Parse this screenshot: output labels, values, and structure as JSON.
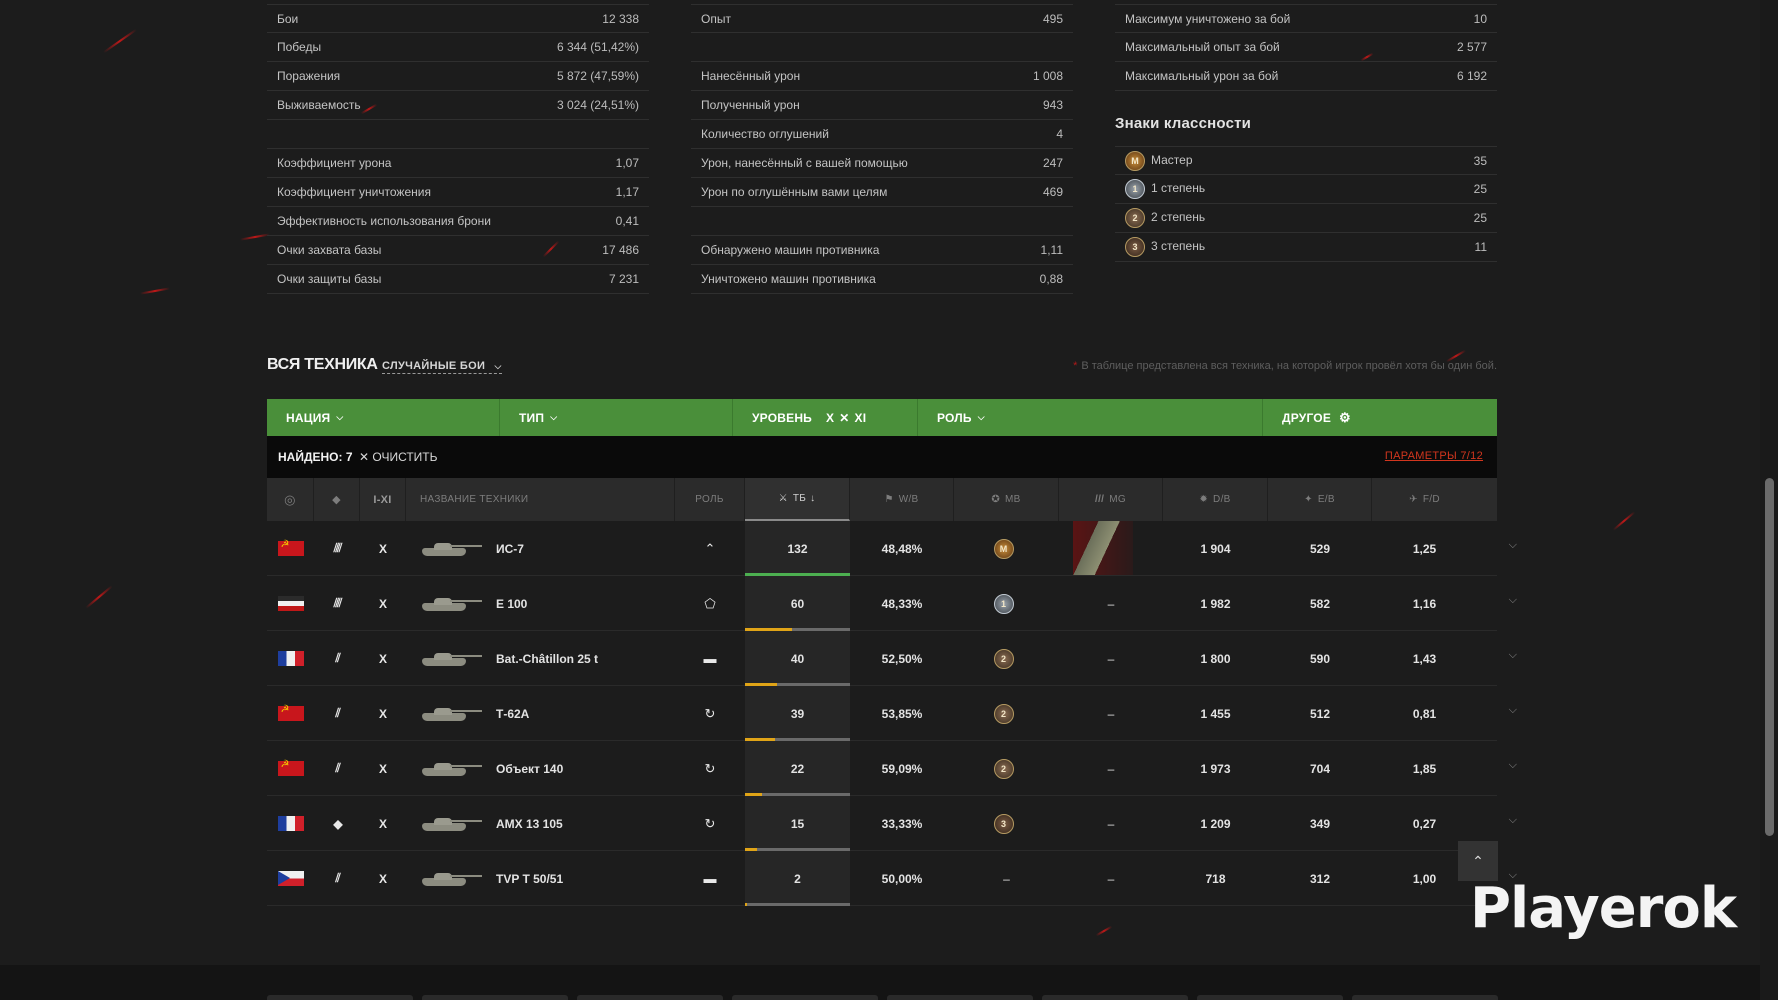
{
  "stats": {
    "col1": [
      {
        "label": "Бои",
        "value": "12 338"
      },
      {
        "label": "Победы",
        "value": "6 344 (51,42%)"
      },
      {
        "label": "Поражения",
        "value": "5 872 (47,59%)"
      },
      {
        "label": "Выживаемость",
        "value": "3 024 (24,51%)"
      },
      null,
      {
        "label": "Коэффициент урона",
        "value": "1,07"
      },
      {
        "label": "Коэффициент уничтожения",
        "value": "1,17"
      },
      {
        "label": "Эффективность использования брони",
        "value": "0,41"
      },
      {
        "label": "Очки захвата базы",
        "value": "17 486"
      },
      {
        "label": "Очки защиты базы",
        "value": "7 231"
      }
    ],
    "col2": [
      {
        "label": "Опыт",
        "value": "495"
      },
      null,
      {
        "label": "Нанесённый урон",
        "value": "1 008"
      },
      {
        "label": "Полученный урон",
        "value": "943"
      },
      {
        "label": "Количество оглушений",
        "value": "4"
      },
      {
        "label": "Урон, нанесённый с вашей помощью",
        "value": "247"
      },
      {
        "label": "Урон по оглушённым вами целям",
        "value": "469"
      },
      null,
      {
        "label": "Обнаружено машин противника",
        "value": "1,11"
      },
      {
        "label": "Уничтожено машин противника",
        "value": "0,88"
      }
    ],
    "col3": [
      {
        "label": "Максимум уничтожено за бой",
        "value": "10"
      },
      {
        "label": "Максимальный опыт за бой",
        "value": "2 577"
      },
      {
        "label": "Максимальный урон за бой",
        "value": "6 192"
      }
    ],
    "class_marks_title": "Знаки классности",
    "class_marks": [
      {
        "medal": "М",
        "label": "Мастер",
        "value": "35",
        "cls": "m"
      },
      {
        "medal": "1",
        "label": "1 степень",
        "value": "25",
        "cls": "s1"
      },
      {
        "medal": "2",
        "label": "2 степень",
        "value": "25",
        "cls": "s2"
      },
      {
        "medal": "3",
        "label": "3 степень",
        "value": "11",
        "cls": "s3"
      }
    ]
  },
  "section": {
    "title": "ВСЯ ТЕХНИКА",
    "battle_type": "СЛУЧАЙНЫЕ БОИ",
    "note": "В таблице представлена вся техника, на которой игрок провёл хотя бы один бой."
  },
  "filters": {
    "nation": "НАЦИЯ",
    "type": "ТИП",
    "level": "УРОВЕНЬ",
    "level_value": "X",
    "level_value2": "XI",
    "role": "РОЛЬ",
    "other": "ДРУГОЕ"
  },
  "found": {
    "label": "НАЙДЕНО: 7",
    "clear": "ОЧИСТИТЬ",
    "params": "ПАРАМЕТРЫ 7/12"
  },
  "columns": {
    "levels": "I-XI",
    "name": "НАЗВАНИЕ ТЕХНИКИ",
    "role": "РОЛЬ",
    "tb": "ТБ",
    "wb": "W/B",
    "mb": "МВ",
    "mg": "MG",
    "db": "D/B",
    "eb": "E/B",
    "fd": "F/D"
  },
  "rows": [
    {
      "flag": "ussr",
      "type": "heavy-tank-icon",
      "type_glyph": "⫽⫽",
      "level": "X",
      "name": "ИС-7",
      "role": "⌃",
      "tb": "132",
      "tb_pct": 100,
      "tb_color": "#4caf50",
      "wb": "48,48%",
      "mb": "М",
      "mb_cls": "m",
      "mg": "",
      "mg_stripe": true,
      "db": "1 904",
      "eb": "529",
      "fd": "1,25"
    },
    {
      "flag": "germany",
      "type": "heavy-tank-icon",
      "type_glyph": "⫽⫽",
      "level": "X",
      "name": "E 100",
      "role": "⬠",
      "tb": "60",
      "tb_pct": 45,
      "tb_color": "#e0a417",
      "wb": "48,33%",
      "mb": "1",
      "mb_cls": "s1",
      "mg": "–",
      "db": "1 982",
      "eb": "582",
      "fd": "1,16"
    },
    {
      "flag": "france",
      "type": "medium-tank-icon",
      "type_glyph": "⫽",
      "level": "X",
      "name": "Bat.-Châtillon 25 t",
      "role": "▬",
      "tb": "40",
      "tb_pct": 30,
      "tb_color": "#e0a417",
      "wb": "52,50%",
      "mb": "2",
      "mb_cls": "s2",
      "mg": "–",
      "db": "1 800",
      "eb": "590",
      "fd": "1,43"
    },
    {
      "flag": "ussr",
      "type": "medium-tank-icon",
      "type_glyph": "⫽",
      "level": "X",
      "name": "Т-62А",
      "role": "↻",
      "tb": "39",
      "tb_pct": 29,
      "tb_color": "#e0a417",
      "wb": "53,85%",
      "mb": "2",
      "mb_cls": "s2",
      "mg": "–",
      "db": "1 455",
      "eb": "512",
      "fd": "0,81"
    },
    {
      "flag": "ussr",
      "type": "medium-tank-icon",
      "type_glyph": "⫽",
      "level": "X",
      "name": "Объект 140",
      "role": "↻",
      "tb": "22",
      "tb_pct": 16,
      "tb_color": "#e0a417",
      "wb": "59,09%",
      "mb": "2",
      "mb_cls": "s2",
      "mg": "–",
      "db": "1 973",
      "eb": "704",
      "fd": "1,85"
    },
    {
      "flag": "france",
      "type": "light-tank-icon",
      "type_glyph": "◆",
      "level": "X",
      "name": "AMX 13 105",
      "role": "↻",
      "tb": "15",
      "tb_pct": 11,
      "tb_color": "#e0a417",
      "wb": "33,33%",
      "mb": "3",
      "mb_cls": "s3",
      "mg": "–",
      "db": "1 209",
      "eb": "349",
      "fd": "0,27"
    },
    {
      "flag": "czech",
      "type": "medium-tank-icon",
      "type_glyph": "⫽",
      "level": "X",
      "name": "TVP T 50/51",
      "role": "▬",
      "tb": "2",
      "tb_pct": 2,
      "tb_color": "#e0a417",
      "wb": "50,00%",
      "mb": "–",
      "mb_cls": "",
      "mg": "–",
      "db": "718",
      "eb": "312",
      "fd": "1,00"
    }
  ],
  "watermark": "Playerok"
}
